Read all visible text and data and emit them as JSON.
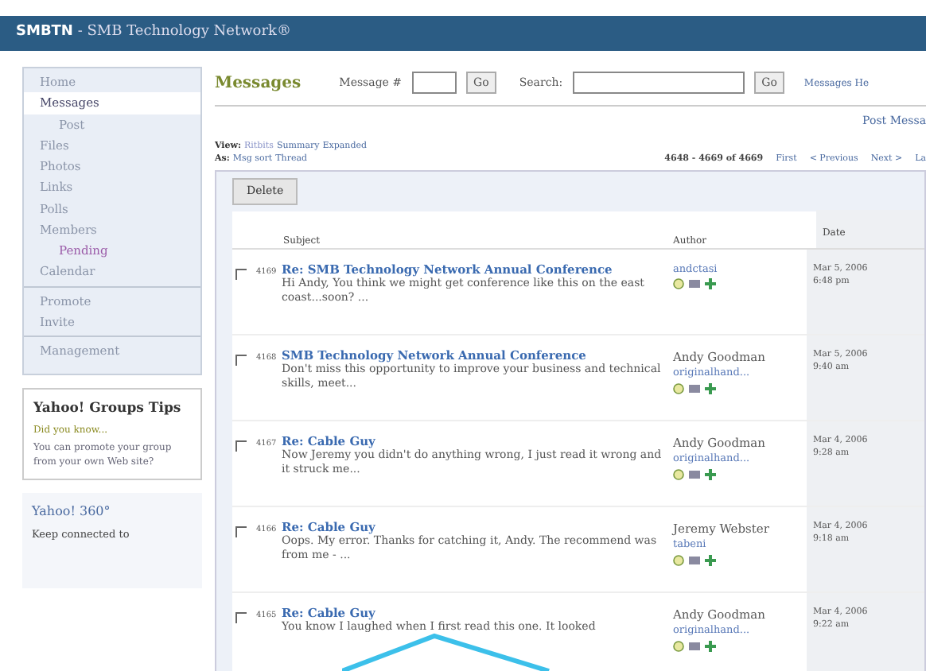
{
  "header": {
    "brand": "SMBTN",
    "title": " - SMB Technology Network®"
  },
  "sidebar": {
    "groups": [
      [
        {
          "label": "Home",
          "selected": false
        },
        {
          "label": "Messages",
          "selected": true,
          "children": [
            {
              "label": "Post",
              "selected": false
            }
          ]
        },
        {
          "label": "Files",
          "selected": false
        },
        {
          "label": "Photos",
          "selected": false
        },
        {
          "label": "Links",
          "selected": false
        },
        {
          "label": "Polls",
          "selected": false
        },
        {
          "label": "Members",
          "selected": false,
          "children": [
            {
              "label": "Pending",
              "selected": false
            }
          ]
        },
        {
          "label": "Calendar",
          "selected": false
        }
      ],
      [
        {
          "label": "Promote",
          "selected": false
        },
        {
          "label": "Invite",
          "selected": false
        }
      ],
      [
        {
          "label": "Management",
          "selected": false
        }
      ]
    ],
    "tips": {
      "title": "Yahoo! Groups Tips",
      "lead": "Did you know...",
      "body": "You can promote your group from your own Web site?"
    },
    "promo": {
      "title": "Yahoo! 360°",
      "body": "Keep connected to"
    }
  },
  "main": {
    "title": "Messages",
    "message_label": "Message #",
    "go": "Go",
    "search_label": "Search:",
    "search_go": "Go",
    "help_link": "Messages He",
    "post_link": "Post Messa",
    "view_label": "View:",
    "view_options": [
      {
        "label": "Ritbits",
        "selected": true
      },
      {
        "label": "Summary",
        "selected": false
      },
      {
        "label": "Expanded",
        "selected": false
      }
    ],
    "sort_label": "As:",
    "sort_options": [
      {
        "label": "Msg sort",
        "selected": false
      },
      {
        "label": "Thread",
        "selected": false
      }
    ],
    "range": "4648 - 4669 of 4669",
    "pager": [
      "First",
      "< Previous",
      "Next >",
      "La"
    ],
    "delete": "Delete",
    "columns": [
      "Subject",
      "Author",
      "Date"
    ],
    "rows": [
      {
        "number": "4169",
        "subject": "Re: SMB Technology Network Annual Conference",
        "snippet": "Hi Andy, You think we might get conference like this on the east coast...soon? ...",
        "handle": "andctasi",
        "date": "Mar 5, 2006",
        "time": "6:48 pm",
        "checked": false
      },
      {
        "number": "4168",
        "subject": "SMB Technology Network Annual Conference",
        "snippet": "Don't miss this opportunity to improve your business and technical skills, meet...",
        "author": "Andy Goodman",
        "handle": "originalhand...",
        "date": "Mar 5, 2006",
        "time": "9:40 am",
        "checked": false
      },
      {
        "number": "4167",
        "subject": "Re: Cable Guy",
        "snippet": "Now Jeremy you didn't do anything wrong, I just read it wrong and it struck me...",
        "author": "Andy Goodman",
        "handle": "originalhand...",
        "date": "Mar 4, 2006",
        "time": "9:28 am",
        "checked": false
      },
      {
        "number": "4166",
        "subject": "Re: Cable Guy",
        "snippet": "Oops. My error. Thanks for catching it, Andy. The recommend was from me - ...",
        "author": "Jeremy Webster",
        "handle": "tabeni",
        "date": "Mar 4, 2006",
        "time": "9:18 am",
        "checked": false
      },
      {
        "number": "4165",
        "subject": "Re: Cable Guy",
        "snippet": "You know I laughed when I first read this one. It looked",
        "author": "Andy Goodman",
        "handle": "originalhand...",
        "date": "Mar 4, 2006",
        "time": "9:22 am",
        "checked": false
      }
    ]
  }
}
